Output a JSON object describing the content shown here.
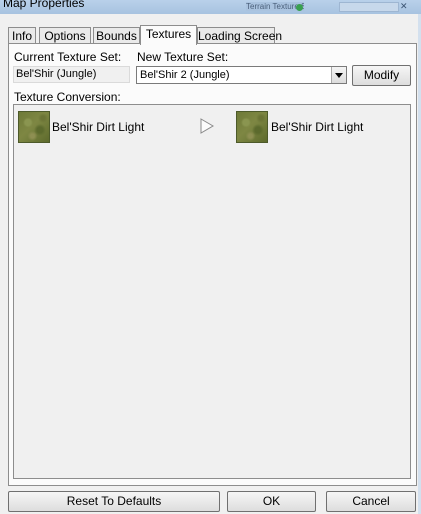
{
  "window": {
    "title": "Map Properties",
    "background_title": "Terrain Texture Sets"
  },
  "tabs": [
    {
      "label": "Info",
      "active": false
    },
    {
      "label": "Options",
      "active": false
    },
    {
      "label": "Bounds",
      "active": false
    },
    {
      "label": "Textures",
      "active": true
    },
    {
      "label": "Loading Screen",
      "active": false
    }
  ],
  "textures": {
    "current_label": "Current Texture Set:",
    "current_value": "Bel'Shir (Jungle)",
    "new_label": "New Texture Set:",
    "new_value": "Bel'Shir 2 (Jungle)",
    "modify_label": "Modify",
    "conversion_label": "Texture Conversion:",
    "conversions": [
      {
        "from": "Bel'Shir Dirt Light",
        "to": "Bel'Shir Dirt Light"
      }
    ]
  },
  "footer": {
    "reset_label": "Reset To Defaults",
    "ok_label": "OK",
    "cancel_label": "Cancel"
  },
  "colors": {
    "dialog_bg": "#f0f0f0",
    "panel_bg": "#fbfbfb",
    "titlebar": "#b9d1ea",
    "texture_green": "#6e7a38"
  }
}
